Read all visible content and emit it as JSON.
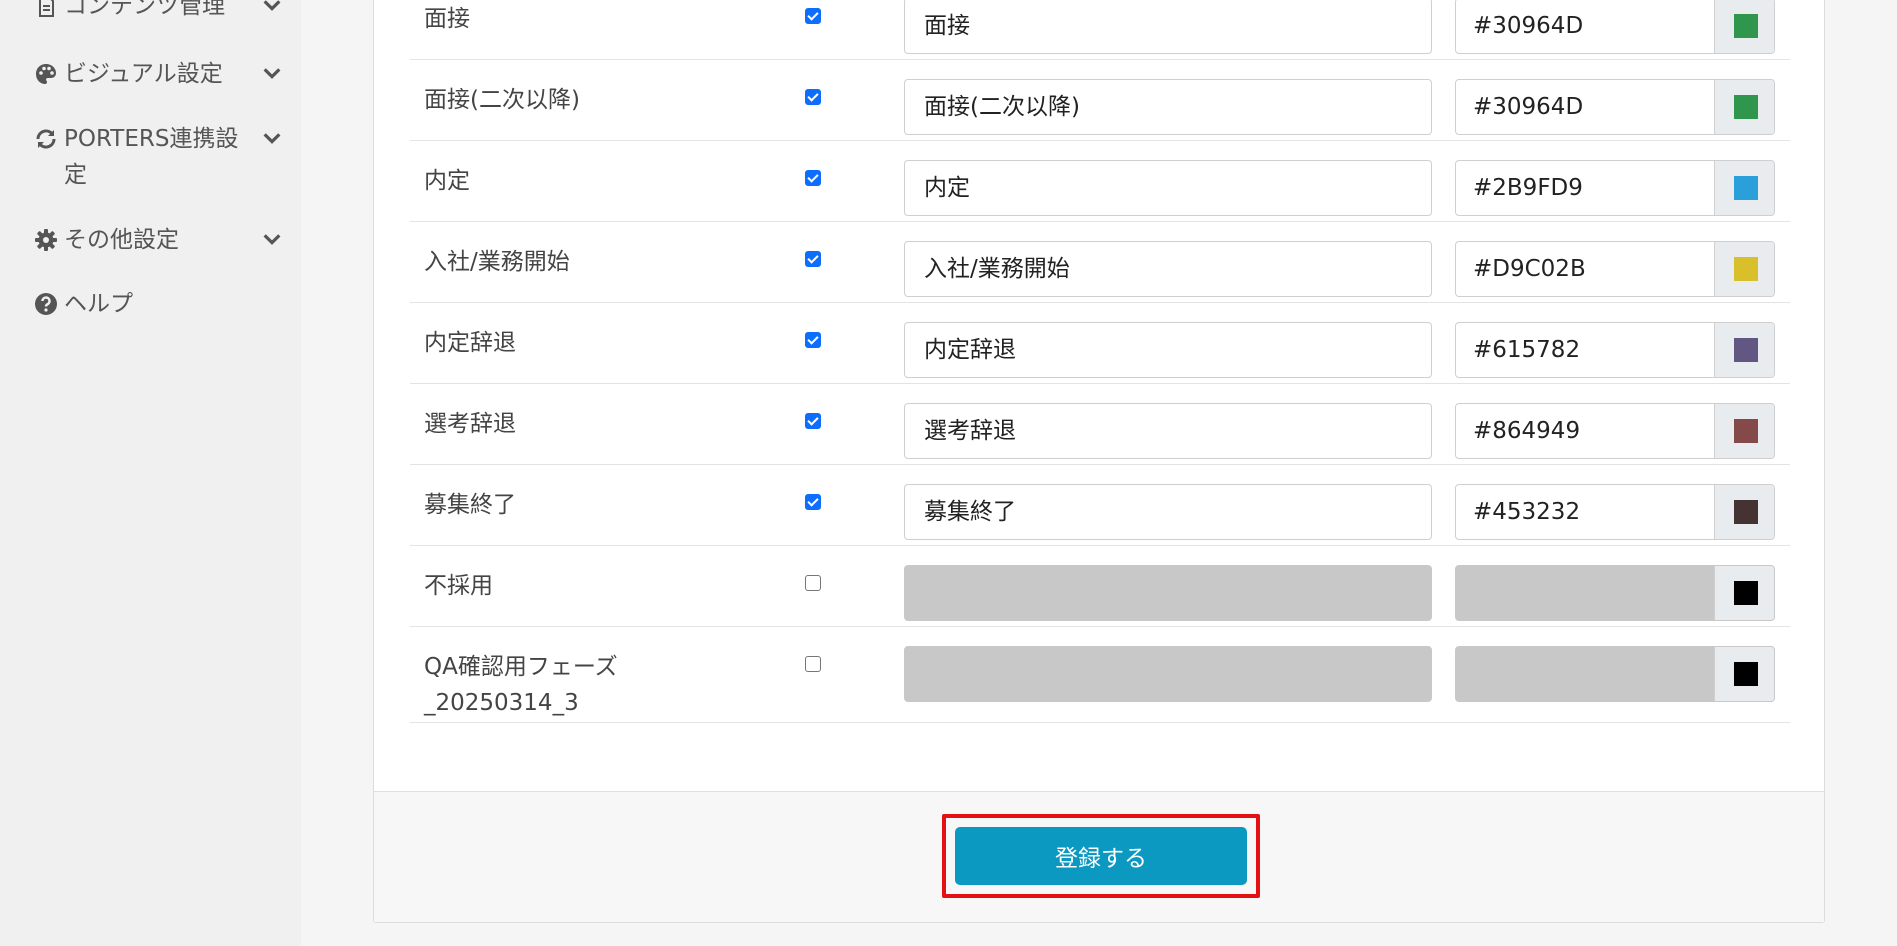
{
  "sidebar": {
    "items": [
      {
        "label": "コンテンツ管理",
        "icon": "file-text-icon"
      },
      {
        "label": "ビジュアル設定",
        "icon": "palette-icon"
      },
      {
        "label": "PORTERS連携設定",
        "icon": "sync-icon"
      },
      {
        "label": "その他設定",
        "icon": "gear-icon"
      },
      {
        "label": "ヘルプ",
        "icon": "question-circle-icon"
      }
    ]
  },
  "phases": [
    {
      "name": "面接",
      "enabled": true,
      "display_name": "面接",
      "color": "#30964D"
    },
    {
      "name": "面接(二次以降)",
      "enabled": true,
      "display_name": "面接(二次以降)",
      "color": "#30964D"
    },
    {
      "name": "内定",
      "enabled": true,
      "display_name": "内定",
      "color": "#2B9FD9"
    },
    {
      "name": "入社/業務開始",
      "enabled": true,
      "display_name": "入社/業務開始",
      "color": "#D9C02B"
    },
    {
      "name": "内定辞退",
      "enabled": true,
      "display_name": "内定辞退",
      "color": "#615782"
    },
    {
      "name": "選考辞退",
      "enabled": true,
      "display_name": "選考辞退",
      "color": "#864949"
    },
    {
      "name": "募集終了",
      "enabled": true,
      "display_name": "募集終了",
      "color": "#453232"
    },
    {
      "name": "不採用",
      "enabled": false,
      "display_name": "",
      "color": "",
      "swatch": "#000000"
    },
    {
      "name": "QA確認用フェーズ_20250314_3",
      "name_lines": [
        "QA確認用フェーズ",
        "_20250314_3"
      ],
      "enabled": false,
      "display_name": "",
      "color": "",
      "swatch": "#000000"
    }
  ],
  "footer": {
    "submit_label": "登録する"
  },
  "colors": {
    "accent": "#0b98c1",
    "highlight": "#e31014"
  }
}
